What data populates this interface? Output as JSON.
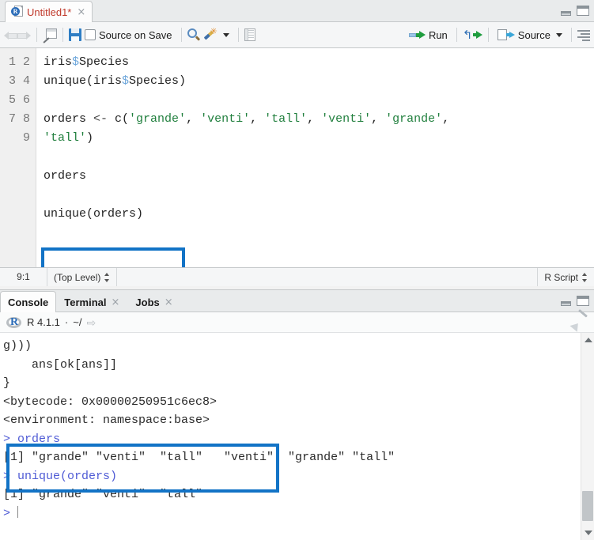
{
  "source_pane": {
    "tab": {
      "title": "Untitled1*",
      "icon": "r-document-icon",
      "close": "×"
    },
    "window_controls": {
      "minimize": "minimize-icon",
      "maximize": "maximize-icon"
    },
    "toolbar": {
      "back_icon": "back-arrow-icon",
      "forward_icon": "forward-arrow-icon",
      "popout_icon": "show-in-new-window-icon",
      "save_icon": "save-icon",
      "source_on_save_label": "Source on Save",
      "find_icon": "find-replace-icon",
      "codetools_icon": "magic-wand-icon",
      "compile_icon": "compile-report-icon",
      "run_label": "Run",
      "rerun_icon": "rerun-previous-icon",
      "source_label": "Source",
      "outline_icon": "document-outline-icon"
    },
    "editor": {
      "line_numbers": [
        "1",
        "2",
        "3",
        "4",
        "",
        "5",
        "6",
        "7",
        "8",
        "9"
      ],
      "lines": [
        {
          "n": "1",
          "text": "iris$Species"
        },
        {
          "n": "2",
          "text": "unique(iris$Species)"
        },
        {
          "n": "3",
          "text": ""
        },
        {
          "n": "4",
          "text": "orders <- c('grande', 'venti', 'tall', 'venti', 'grande',"
        },
        {
          "n": "",
          "text": "'tall')"
        },
        {
          "n": "5",
          "text": ""
        },
        {
          "n": "6",
          "text": "orders"
        },
        {
          "n": "7",
          "text": ""
        },
        {
          "n": "8",
          "text": "unique(orders)"
        },
        {
          "n": "9",
          "text": ""
        }
      ],
      "highlight_line": "unique(orders)"
    },
    "statusbar": {
      "cursor_position": "9:1",
      "scope": "(Top Level)",
      "file_type": "R Script"
    }
  },
  "console_pane": {
    "tabs": [
      {
        "label": "Console",
        "closable": false,
        "active": true
      },
      {
        "label": "Terminal",
        "closable": true,
        "active": false
      },
      {
        "label": "Jobs",
        "closable": true,
        "active": false
      }
    ],
    "close_glyph": "×",
    "info": {
      "r_version": "R 4.1.1",
      "separator": "·",
      "working_dir": "~/",
      "shortcut_icon": "view-directory-icon",
      "clear_icon": "broom-clear-console-icon"
    },
    "output": [
      {
        "type": "output",
        "text": "g)))"
      },
      {
        "type": "output",
        "text": "    ans[ok[ans]]"
      },
      {
        "type": "output",
        "text": "}"
      },
      {
        "type": "output",
        "text": "<bytecode: 0x00000250951c6ec8>"
      },
      {
        "type": "output",
        "text": "<environment: namespace:base>"
      },
      {
        "type": "input",
        "text": "> orders"
      },
      {
        "type": "output",
        "text": "[1] \"grande\" \"venti\"  \"tall\"   \"venti\"  \"grande\" \"tall\""
      },
      {
        "type": "input",
        "text": "> unique(orders)"
      },
      {
        "type": "output",
        "text": "[1] \"grande\" \"venti\"  \"tall\""
      },
      {
        "type": "input",
        "text": "> "
      }
    ],
    "window_controls": {
      "minimize": "minimize-icon",
      "maximize": "maximize-icon"
    },
    "scrollbar": {
      "up": "scroll-up-icon",
      "down": "scroll-down-icon"
    }
  },
  "colors": {
    "highlight_box": "#1273c6",
    "string": "#207f3d",
    "prompt": "#4f5bd5",
    "tab_title": "#c0392b"
  }
}
